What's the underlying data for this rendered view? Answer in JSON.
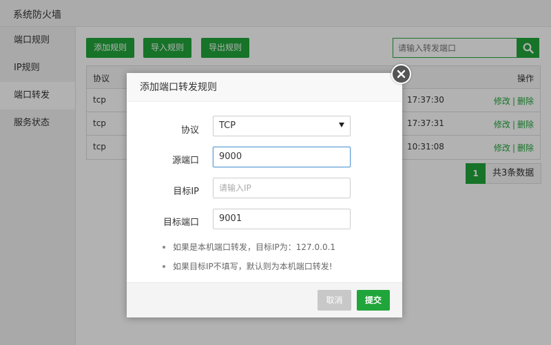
{
  "window": {
    "title": "系统防火墙"
  },
  "sidebar": {
    "items": [
      {
        "label": "端口规则"
      },
      {
        "label": "IP规则"
      },
      {
        "label": "端口转发"
      },
      {
        "label": "服务状态"
      }
    ]
  },
  "toolbar": {
    "add_label": "添加规则",
    "import_label": "导入规则",
    "export_label": "导出规则",
    "search_placeholder": "请输入转发端口"
  },
  "table": {
    "headers": {
      "protocol": "协议",
      "actions": "操作"
    },
    "rows": [
      {
        "protocol": "tcp",
        "time": "17:37:30",
        "edit": "修改",
        "sep": "|",
        "delete": "删除"
      },
      {
        "protocol": "tcp",
        "time": "17:37:31",
        "edit": "修改",
        "sep": "|",
        "delete": "删除"
      },
      {
        "protocol": "tcp",
        "time": "10:31:08",
        "edit": "修改",
        "sep": "|",
        "delete": "删除"
      }
    ]
  },
  "pagination": {
    "current": "1",
    "total": "共3条数据"
  },
  "modal": {
    "title": "添加端口转发规则",
    "fields": {
      "protocol_label": "协议",
      "protocol_value": "TCP",
      "source_port_label": "源端口",
      "source_port_value": "9000",
      "target_ip_label": "目标IP",
      "target_ip_placeholder": "请输入IP",
      "target_port_label": "目标端口",
      "target_port_value": "9001"
    },
    "tips": [
      "如果是本机端口转发，目标IP为：127.0.0.1",
      "如果目标IP不填写，默认则为本机端口转发!"
    ],
    "cancel_label": "取消",
    "submit_label": "提交"
  },
  "colors": {
    "accent": "#20a53a",
    "overlay": "rgba(0,0,0,0.3)",
    "cancel": "#c8c8c8"
  }
}
